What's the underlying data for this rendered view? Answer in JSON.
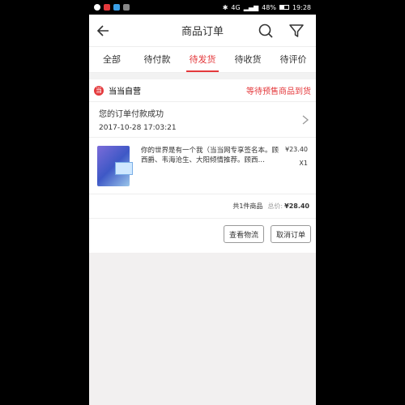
{
  "status_bar": {
    "network": "4G",
    "battery": "48%",
    "time": "19:28"
  },
  "header": {
    "title": "商品订单"
  },
  "tabs": [
    {
      "label": "全部",
      "active": false
    },
    {
      "label": "待付款",
      "active": false
    },
    {
      "label": "待发货",
      "active": true
    },
    {
      "label": "待收货",
      "active": false
    },
    {
      "label": "待评价",
      "active": false
    }
  ],
  "shop": {
    "logo": "当",
    "name": "当当自营",
    "status": "等待预售商品到货"
  },
  "order_info": {
    "message": "您的订单付款成功",
    "datetime": "2017-10-28 17:03:21"
  },
  "item": {
    "title": "你的世界是有一个我（当当网专享签名本。顾西爵、韦海沧生、大阳倾情推荐。顾西…",
    "price": "¥23.40",
    "quantity": "X1"
  },
  "summary": {
    "count_text": "共1件商品",
    "total_label": "总价:",
    "total_amount": "¥28.40"
  },
  "buttons": {
    "logistics": "查看物流",
    "cancel": "取消订单"
  },
  "colors": {
    "accent": "#e4393c"
  }
}
